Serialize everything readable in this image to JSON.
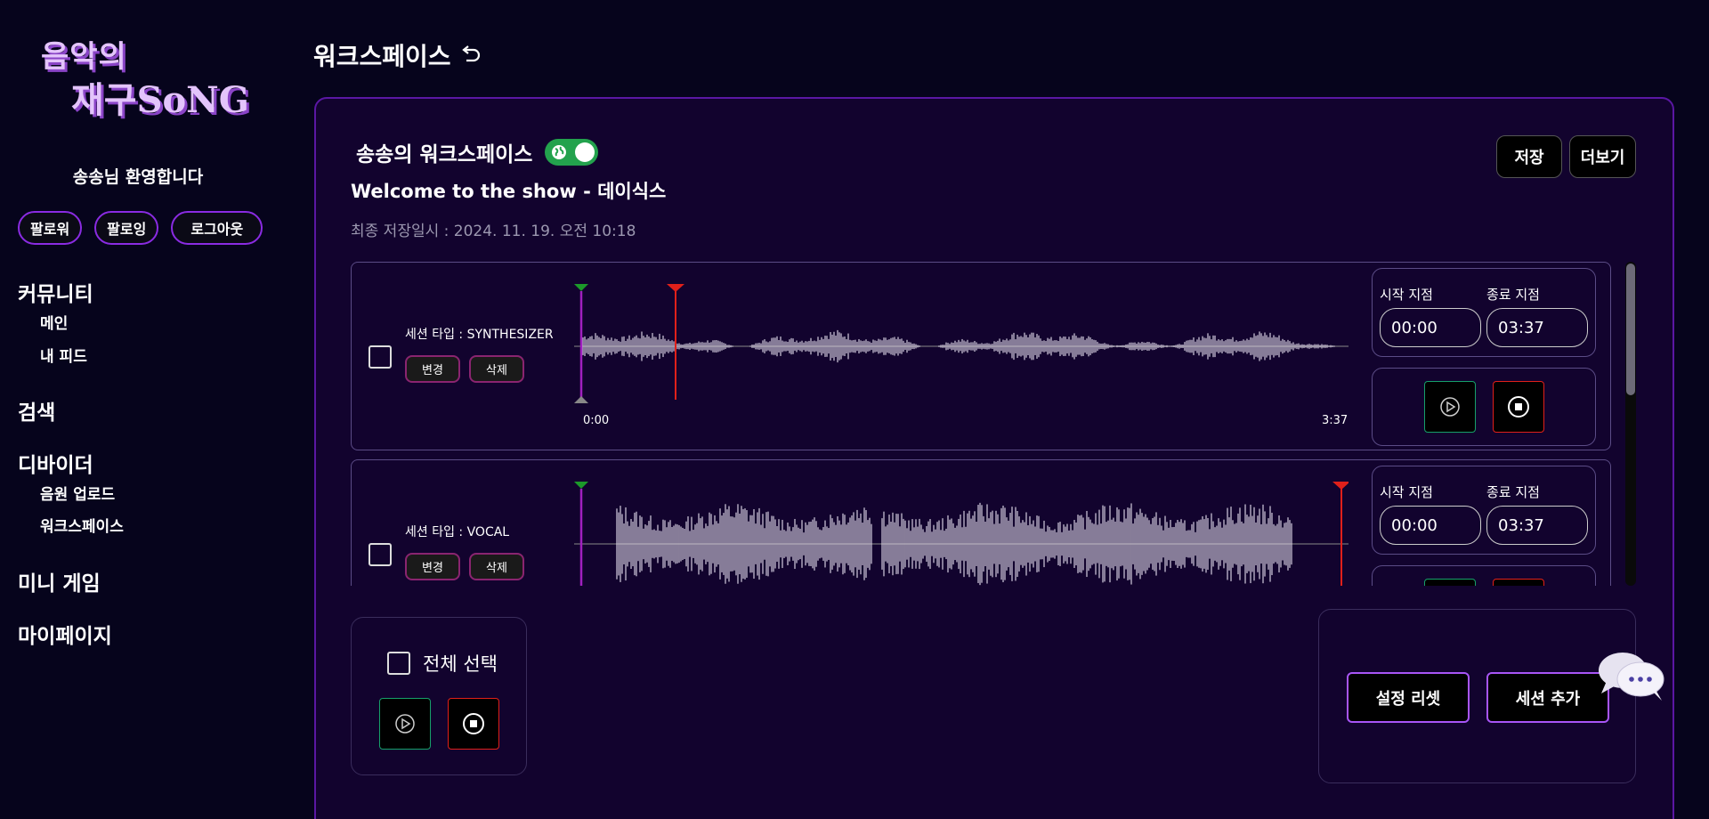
{
  "logo": {
    "line1": "음악의",
    "line2": "재구SoNG"
  },
  "sidebar": {
    "welcome": "송송님 환영합니다",
    "follower": "팔로워",
    "following": "팔로잉",
    "logout": "로그아웃",
    "community": "커뮤니티",
    "main": "메인",
    "my_feed": "내 피드",
    "search": "검색",
    "divider": "디바이더",
    "upload": "음원 업로드",
    "workspace": "워크스페이스",
    "mini_game": "미니 게임",
    "mypage": "마이페이지"
  },
  "header": {
    "title": "워크스페이스"
  },
  "workspace": {
    "name": "송송의 워크스페이스",
    "song": "Welcome to the show - 데이식스",
    "saved_at": "최종 저장일시 : 2024. 11. 19. 오전 10:18",
    "save": "저장",
    "more": "더보기"
  },
  "tracks": [
    {
      "type": "세션 타입 : SYNTHESIZER",
      "change": "변경",
      "delete": "삭제",
      "start_label": "시작 지점",
      "end_label": "종료 지점",
      "start": "00:00",
      "end": "03:37",
      "time_start": "0:00",
      "time_end": "3:37"
    },
    {
      "type": "세션 타입 : VOCAL",
      "change": "변경",
      "delete": "삭제",
      "start_label": "시작 지점",
      "end_label": "종료 지점",
      "start": "00:00",
      "end": "03:37"
    }
  ],
  "select_all": "전체 선택",
  "actions": {
    "reset": "설정 리셋",
    "add_session": "세션 추가"
  },
  "colors": {
    "accent": "#8a2be2",
    "play": "#16a06a",
    "stop": "#e0201a",
    "toggle": "#23a24d"
  }
}
